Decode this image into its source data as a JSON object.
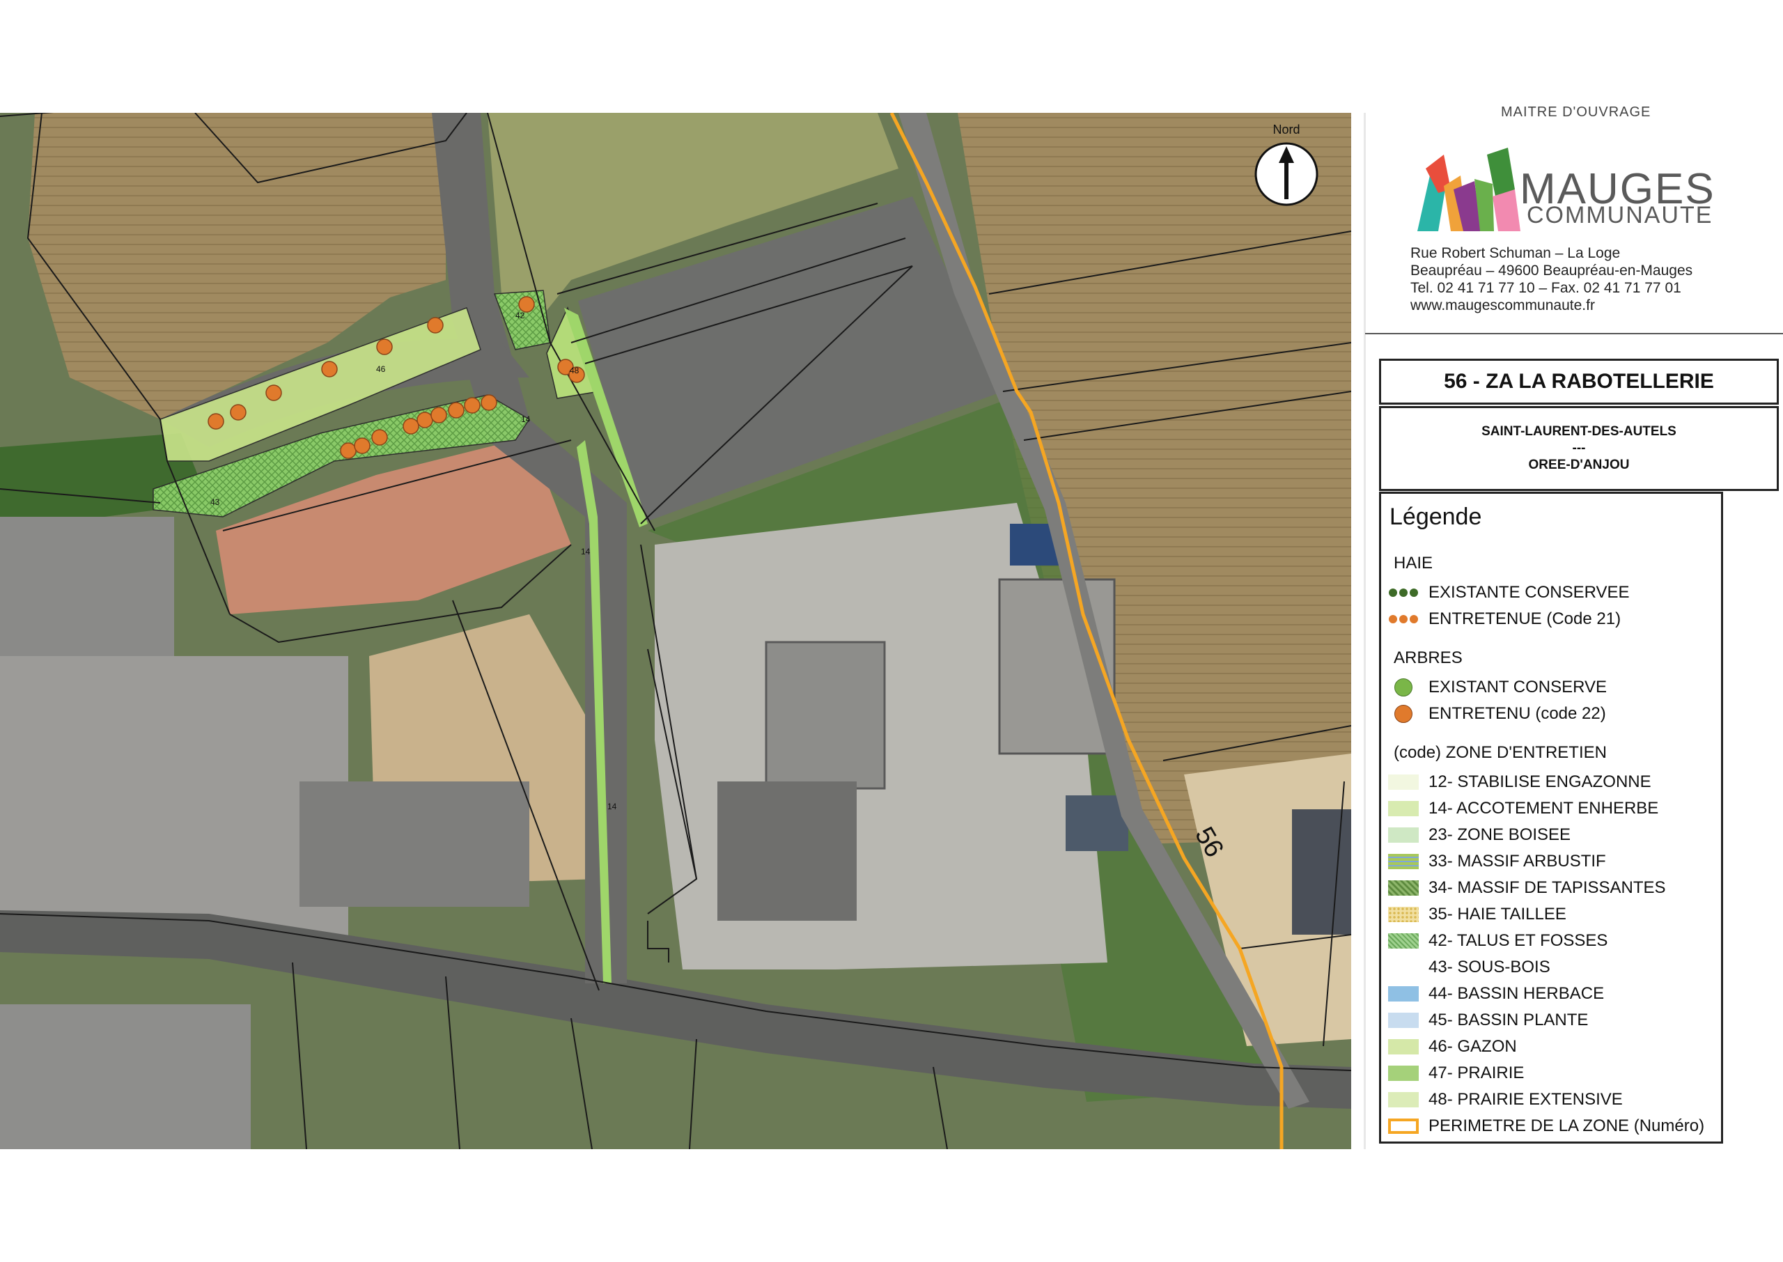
{
  "header": {
    "maitre_ouvrage": "MAITRE D'OUVRAGE",
    "brand_line1": "MAUGES",
    "brand_line2": "COMMUNAUTE",
    "address": [
      "Rue Robert Schuman – La Loge",
      "Beaupréau – 49600 Beaupréau-en-Mauges",
      "Tel. 02 41 71 77 10 – Fax. 02 41 71 77 01",
      "www.maugescommunaute.fr"
    ]
  },
  "zone": {
    "title": "56 - ZA LA RABOTELLERIE",
    "commune": "SAINT-LAURENT-DES-AUTELS",
    "separator": "---",
    "commune_new": "OREE-D'ANJOU"
  },
  "map": {
    "north_label": "Nord",
    "perimeter_label": "56",
    "parcel_labels": [
      "46",
      "42",
      "48",
      "14",
      "43",
      "14",
      "14"
    ]
  },
  "legend": {
    "title": "Légende",
    "sections": [
      {
        "label": "HAIE",
        "items": [
          {
            "label": "EXISTANTE CONSERVEE",
            "kind": "dots",
            "color": "#3e6b28"
          },
          {
            "label": "ENTRETENUE (Code 21)",
            "kind": "dots",
            "color": "#e07a2c"
          }
        ]
      },
      {
        "label": "ARBRES",
        "items": [
          {
            "label": "EXISTANT CONSERVE",
            "kind": "circle",
            "color": "#7ab648"
          },
          {
            "label": "ENTRETENU (code 22)",
            "kind": "circle",
            "color": "#e07a2c"
          }
        ]
      },
      {
        "label": "(code) ZONE D'ENTRETIEN",
        "items": [
          {
            "label": "12- STABILISE ENGAZONNE",
            "kind": "box",
            "color": "#f2f7e0"
          },
          {
            "label": "14- ACCOTEMENT ENHERBE",
            "kind": "box",
            "color": "#d8ebb0"
          },
          {
            "label": "23- ZONE BOISEE",
            "kind": "box",
            "color": "#cfe8c4"
          },
          {
            "label": "33- MASSIF ARBUSTIF",
            "kind": "box",
            "color": "#a8c85a"
          },
          {
            "label": "34- MASSIF DE TAPISSANTES",
            "kind": "box",
            "color": "#8db56a"
          },
          {
            "label": "35- HAIE TAILLEE",
            "kind": "box",
            "color": "#f1dfa0"
          },
          {
            "label": "42- TALUS ET FOSSES",
            "kind": "box",
            "color": "#9fd18f"
          },
          {
            "label": "43- SOUS-BOIS",
            "kind": "box",
            "color": "#ffffff"
          },
          {
            "label": "44- BASSIN HERBACE",
            "kind": "box",
            "color": "#8fc0e4"
          },
          {
            "label": "45- BASSIN PLANTE",
            "kind": "box",
            "color": "#c8dcef"
          },
          {
            "label": "46- GAZON",
            "kind": "box",
            "color": "#d5e8a8"
          },
          {
            "label": "47- PRAIRIE",
            "kind": "box",
            "color": "#a5d17a"
          },
          {
            "label": "48- PRAIRIE EXTENSIVE",
            "kind": "box",
            "color": "#dcecb8"
          },
          {
            "label": "PERIMETRE DE LA ZONE (Numéro)",
            "kind": "outline",
            "color": "#f5a623"
          }
        ]
      }
    ]
  },
  "colors": {
    "perimeter": "#f5a623",
    "hedge_maintained": "#e07a2c",
    "lawn": "#c9e58a",
    "talus": "#8ccf6a"
  }
}
